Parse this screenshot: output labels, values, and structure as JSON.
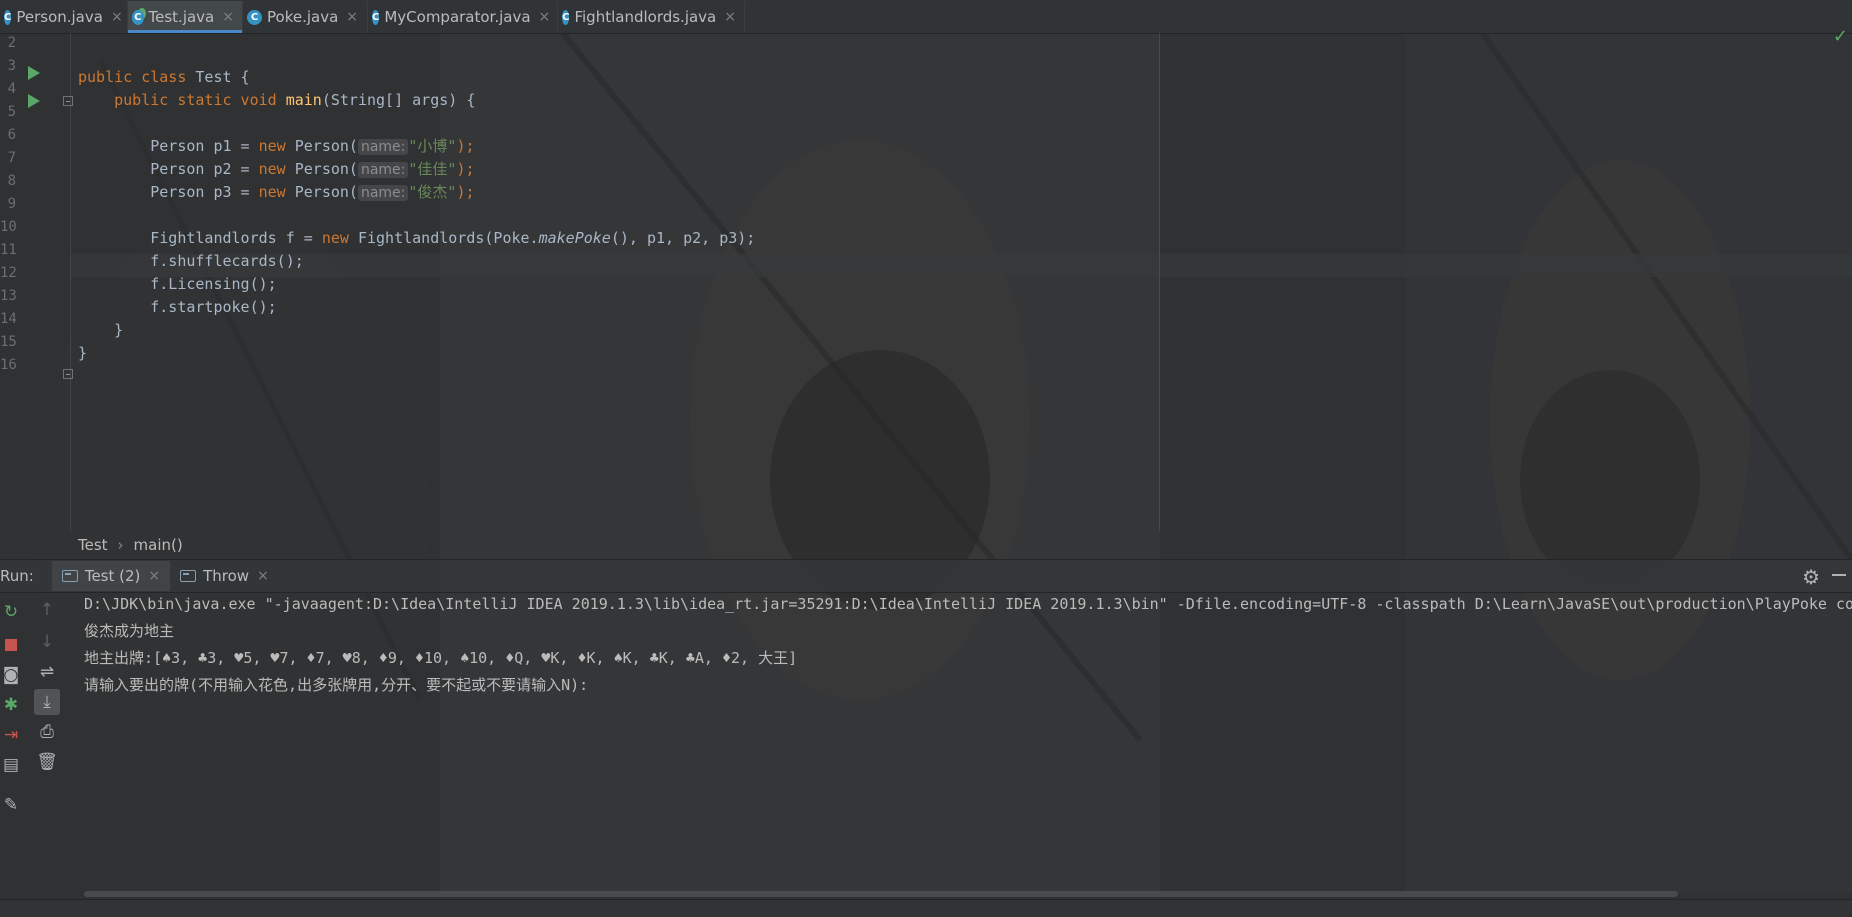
{
  "tabs": [
    {
      "label": "Person.java",
      "active": false
    },
    {
      "label": "Test.java",
      "active": true
    },
    {
      "label": "Poke.java",
      "active": false
    },
    {
      "label": "MyComparator.java",
      "active": false
    },
    {
      "label": "Fightlandlords.java",
      "active": false
    }
  ],
  "class_icon_letter": "C",
  "close_glyph": "×",
  "line_numbers": [
    "2",
    "3",
    "4",
    "5",
    "6",
    "7",
    "8",
    "9",
    "10",
    "11",
    "12",
    "13",
    "14",
    "15",
    "16"
  ],
  "code": {
    "class_decl": {
      "kw": "public class",
      "name": "Test {"
    },
    "main_decl": {
      "kw": "public static void",
      "fn": "main",
      "rest": "(String[] args) {"
    },
    "persons": [
      {
        "left": "Person p1 = ",
        "kw": "new",
        "ctor": " Person(",
        "hint": "name:",
        "str": "\"小博\"",
        "end": ");"
      },
      {
        "left": "Person p2 = ",
        "kw": "new",
        "ctor": " Person(",
        "hint": "name:",
        "str": "\"佳佳\"",
        "end": ");"
      },
      {
        "left": "Person p3 = ",
        "kw": "new",
        "ctor": " Person(",
        "hint": "name:",
        "str": "\"俊杰\"",
        "end": ");"
      }
    ],
    "fight": {
      "left": "Fightlandlords f = ",
      "kw": "new",
      "mid": " Fightlandlords(Poke.",
      "method": "makePoke",
      "end": "(), p1, p2, p3);"
    },
    "calls": [
      "f.shufflecards();",
      "f.Licensing();",
      "f.startpoke();"
    ],
    "close_method": "}",
    "close_class": "}"
  },
  "breadcrumb": {
    "class": "Test",
    "method": "main()",
    "sep": "›"
  },
  "run_panel": {
    "label": "Run:",
    "tabs": [
      {
        "label": "Test (2)",
        "active": true
      },
      {
        "label": "Throw",
        "active": false
      }
    ],
    "gear_icon": "⚙"
  },
  "console_lines": [
    "D:\\JDK\\bin\\java.exe \"-javaagent:D:\\Idea\\IntelliJ IDEA 2019.1.3\\lib\\idea_rt.jar=35291:D:\\Idea\\IntelliJ IDEA 2019.1.3\\bin\" -Dfile.encoding=UTF-8 -classpath D:\\Learn\\JavaSE\\out\\production\\PlayPoke com",
    "俊杰成为地主",
    "地主出牌:[♠3, ♣3, ♥5, ♥7, ♦7, ♥8, ♦9, ♦10, ♠10, ♦Q, ♥K, ♦K, ♠K, ♣K, ♣A, ♦2, 大王]",
    "请输入要出的牌(不用输入花色,出多张牌用,分开、要不起或不要请输入N):"
  ],
  "colors": {
    "keyword": "#cc7832",
    "function": "#ffc66d",
    "string": "#6a8759",
    "accent": "#4a88c7",
    "run_green": "#59a869",
    "stop_red": "#c75450"
  }
}
